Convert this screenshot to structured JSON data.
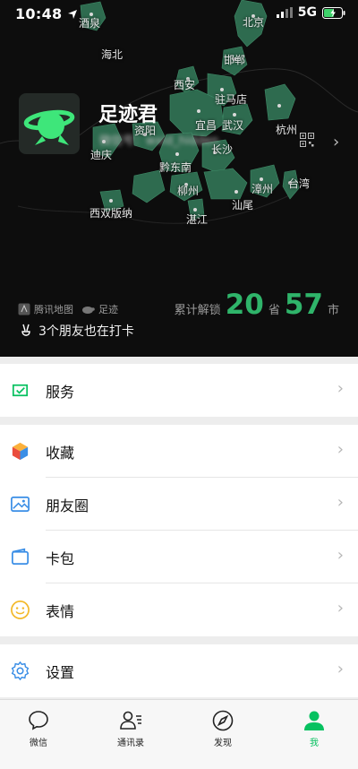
{
  "status_bar": {
    "time": "10:48",
    "network": "5G"
  },
  "profile": {
    "nickname": "足迹君",
    "wechat_id": "微信号：wxid_hidden"
  },
  "map": {
    "cities": [
      "酒泉",
      "北京",
      "海北",
      "邯郸",
      "西安",
      "驻马店",
      "宜昌",
      "武汉",
      "杭州",
      "资阳",
      "长沙",
      "迪庆",
      "黔东南",
      "台湾",
      "漳州",
      "柳州",
      "汕尾",
      "西双版纳",
      "湛江"
    ],
    "brands": [
      "腾讯地图",
      "足迹"
    ],
    "friends_text": "3个朋友也在打卡",
    "unlock_prefix": "累计解锁",
    "province_count": "20",
    "province_unit": "省",
    "city_count": "57",
    "city_unit": "市"
  },
  "menu": {
    "services": "服务",
    "favorites": "收藏",
    "moments": "朋友圈",
    "cards": "卡包",
    "stickers": "表情",
    "settings": "设置"
  },
  "tabs": {
    "chats": "微信",
    "contacts": "通讯录",
    "discover": "发现",
    "me": "我"
  },
  "colors": {
    "accent_green": "#07c160",
    "map_region": "#2e6b4f",
    "unlock_number": "#2fb46a"
  },
  "icons": [
    "location-arrow-icon",
    "signal-icon",
    "battery-charging-icon",
    "avatar-planet-icon",
    "qr-code-icon",
    "chevron-right-icon",
    "tencent-map-icon",
    "turtle-icon",
    "peace-hand-icon",
    "services-icon",
    "favorites-icon",
    "moments-icon",
    "card-wallet-icon",
    "stickers-icon",
    "settings-gear-icon",
    "chat-bubble-icon",
    "contacts-icon",
    "compass-icon",
    "person-icon"
  ]
}
